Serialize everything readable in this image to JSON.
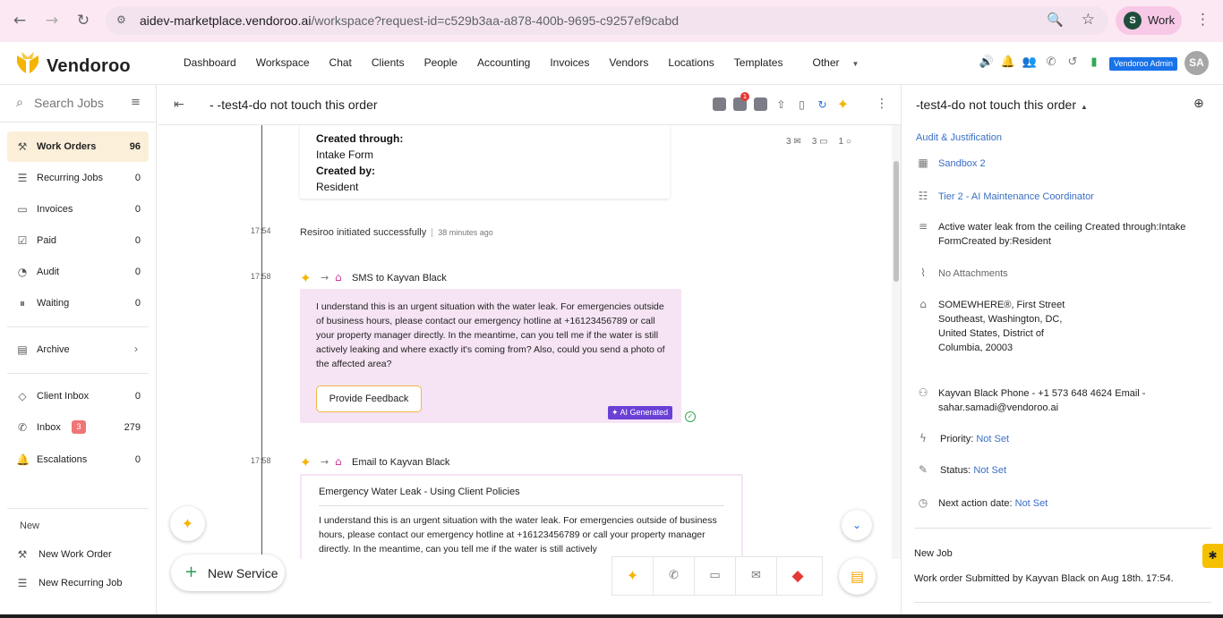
{
  "browser": {
    "url_host": "aidev-marketplace.vendoroo.ai",
    "url_path": "/workspace?request-id=c529b3aa-a878-400b-9695-c9257ef9cabd",
    "profile_initial": "S",
    "profile_label": "Work"
  },
  "app": {
    "brand": "Vendoroo",
    "nav": [
      "Dashboard",
      "Workspace",
      "Chat",
      "Clients",
      "People",
      "Accounting",
      "Invoices",
      "Vendors",
      "Locations",
      "Templates",
      "Other"
    ],
    "admin_badge": "Vendoroo Admin",
    "user_initials": "SA"
  },
  "sidebar": {
    "search_placeholder": "Search Jobs",
    "items": [
      {
        "label": "Work Orders",
        "count": "96",
        "icon": "wrench-icon"
      },
      {
        "label": "Recurring Jobs",
        "count": "0",
        "icon": "list-icon"
      },
      {
        "label": "Invoices",
        "count": "0",
        "icon": "invoice-icon"
      },
      {
        "label": "Paid",
        "count": "0",
        "icon": "checkbox-icon"
      },
      {
        "label": "Audit",
        "count": "0",
        "icon": "pie-icon"
      },
      {
        "label": "Waiting",
        "count": "0",
        "icon": "pause-icon"
      }
    ],
    "archive_label": "Archive",
    "inbox_items": [
      {
        "label": "Client Inbox",
        "count": "0"
      },
      {
        "label": "Inbox",
        "badge": "3",
        "count": "279"
      },
      {
        "label": "Escalations",
        "count": "0"
      }
    ],
    "new_section": "New",
    "new_items": [
      "New Work Order",
      "New Recurring Job"
    ]
  },
  "thread": {
    "title": "-  -test4-do not touch this order",
    "tool_badge": "1",
    "intake": {
      "created_through_label": "Created through:",
      "created_through_value": "Intake Form",
      "created_by_label": "Created by:",
      "created_by_value": "Resident"
    },
    "counters": {
      "emails": "3",
      "chats": "3",
      "comments": "1"
    },
    "events": [
      {
        "time": "17:54",
        "text": "Resiroo initiated successfully",
        "ago": "38 minutes ago"
      },
      {
        "time": "17:58",
        "channel": "SMS to Kayvan Black"
      },
      {
        "time": "17:58",
        "channel": "Email to Kayvan Black"
      }
    ],
    "sms_body": "I understand this is an urgent situation with the water leak. For emergencies outside of business hours, please contact our emergency hotline at +16123456789 or call your property manager directly. In the meantime, can you tell me if the water is still actively leaking and where exactly it's coming from? Also, could you send a photo of the affected area?",
    "feedback_button": "Provide Feedback",
    "ai_tag": "AI Generated",
    "email_subject": "Emergency Water Leak - Using Client Policies",
    "email_body": "I understand this is an urgent situation with the water leak. For emergencies outside of business hours, please contact our emergency hotline at +16123456789 or call your property manager directly. In the meantime, can you tell me if the water is still actively"
  },
  "new_service_label": "New Service",
  "details": {
    "title": "-test4-do not touch this order",
    "audit_link": "Audit & Justification",
    "client": "Sandbox 2",
    "tier": "Tier 2 - AI Maintenance Coordinator",
    "description": "Active water leak from the ceiling Created through:Intake FormCreated by:Resident",
    "attachments": "No Attachments",
    "address": "SOMEWHERE®, First Street Southeast, Washington, DC, United States, District of Columbia, 20003",
    "contact": "Kayvan Black Phone - +1 573 648 4624 Email - sahar.samadi@vendoroo.ai",
    "priority_label": "Priority:",
    "priority_value": "Not Set",
    "status_label": "Status:",
    "status_value": "Not Set",
    "next_action_label": "Next action date:",
    "next_action_value": "Not Set",
    "new_job": "New Job",
    "event": "Work order Submitted by Kayvan Black on Aug 18th. 17:54."
  }
}
